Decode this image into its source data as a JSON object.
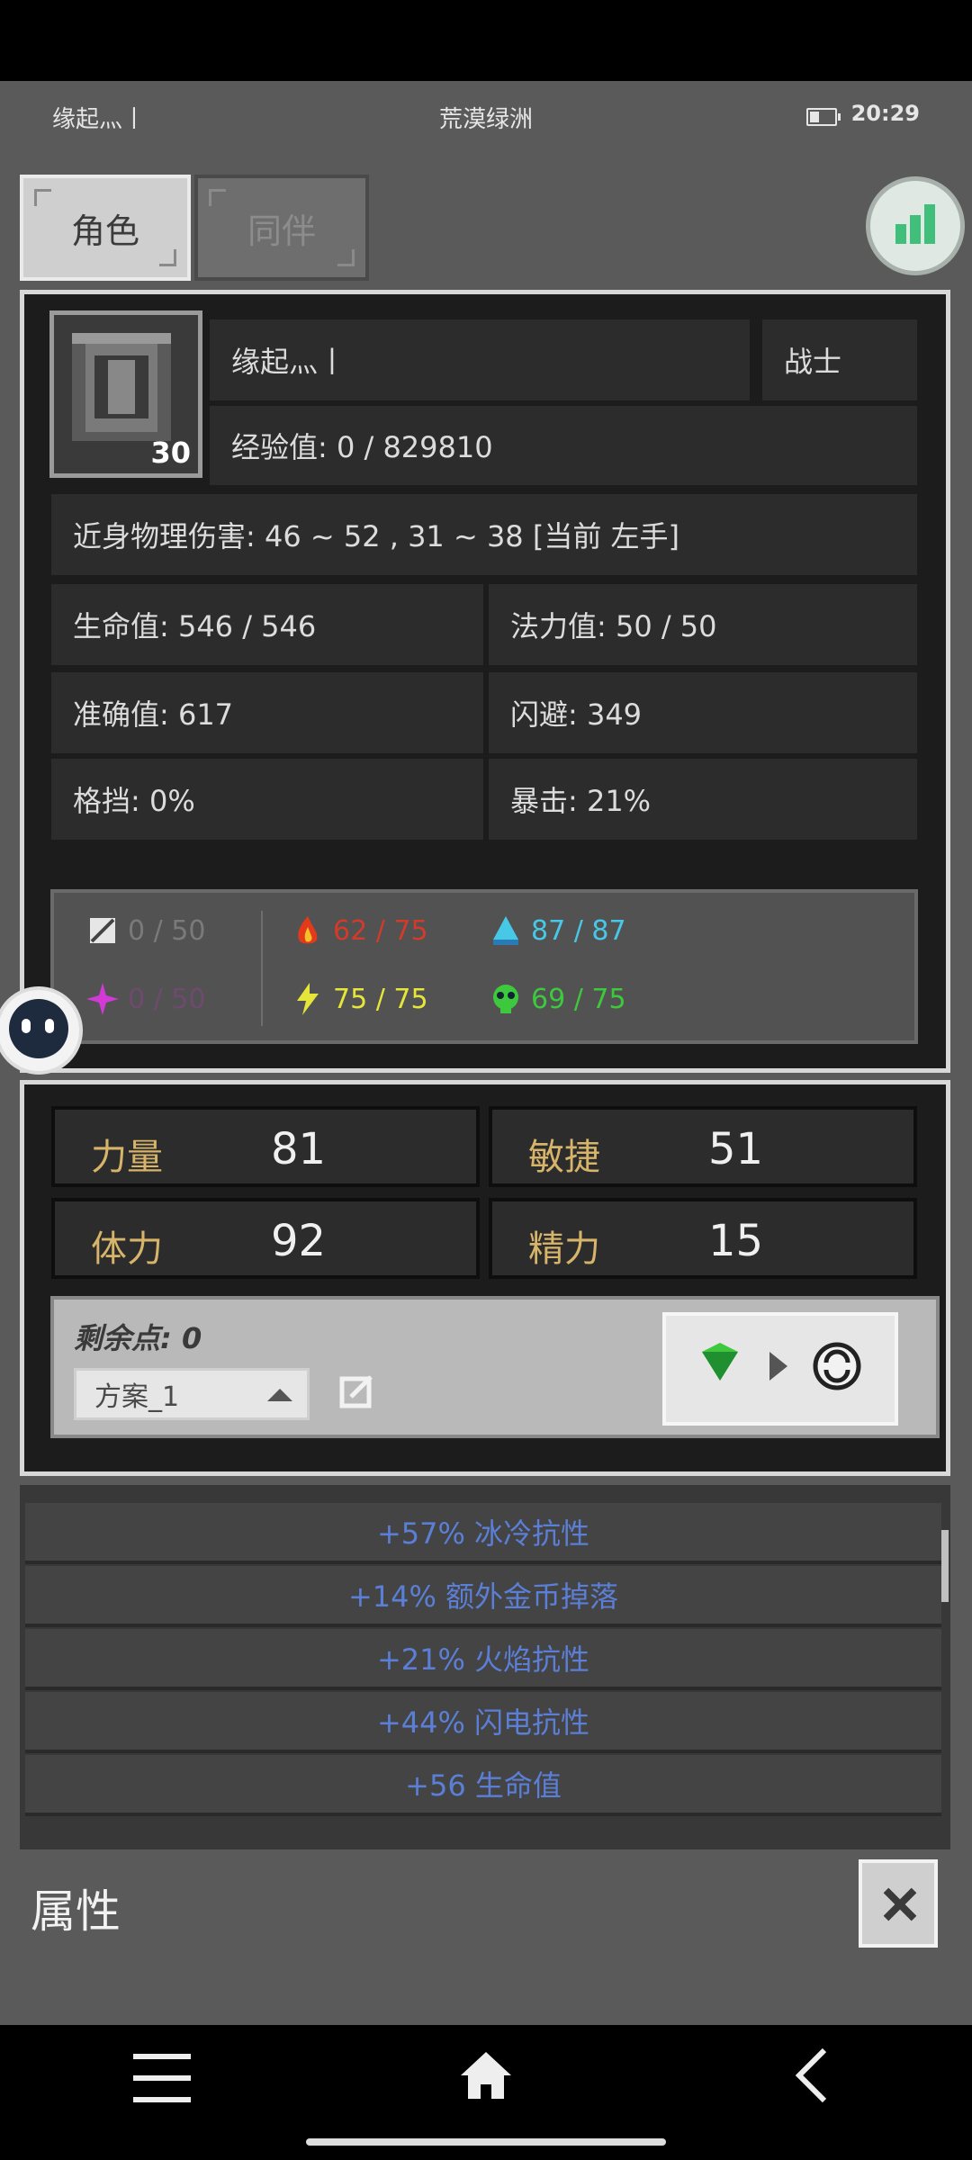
{
  "status_bar": {
    "left_text": "缘起灬丨",
    "title": "荒漠绿洲",
    "time": "20:29"
  },
  "tabs": [
    {
      "label": "角色"
    },
    {
      "label": "同伴"
    }
  ],
  "character": {
    "name": "缘起灬丨",
    "class": "战士",
    "level": "30",
    "exp_text": "经验值: 0 / 829810",
    "melee_damage_text": "近身物理伤害: 46 ~ 52 , 31 ~ 38 [当前 左手]",
    "hp_text": "生命值: 546 / 546",
    "mp_text": "法力值: 50 / 50",
    "accuracy_text": "准确值: 617",
    "dodge_text": "闪避: 349",
    "block_text": "格挡: 0%",
    "crit_text": "暴击: 21%"
  },
  "resistances": [
    {
      "icon": "physical-resist-icon",
      "text": "0 / 50",
      "color": "#7a7a7a"
    },
    {
      "icon": "fire-resist-icon",
      "text": "62 / 75",
      "color": "#d23a2a"
    },
    {
      "icon": "cold-resist-icon",
      "text": "87 / 87",
      "color": "#46c8e6"
    },
    {
      "icon": "magic-resist-icon",
      "text": "0 / 50",
      "color": "#6e4a6e"
    },
    {
      "icon": "lightning-resist-icon",
      "text": "75 / 75",
      "color": "#e6e63a"
    },
    {
      "icon": "poison-resist-icon",
      "text": "69 / 75",
      "color": "#3ec83e"
    }
  ],
  "attributes": [
    {
      "name": "力量",
      "value": "81"
    },
    {
      "name": "敏捷",
      "value": "51"
    },
    {
      "name": "体力",
      "value": "92"
    },
    {
      "name": "精力",
      "value": "15"
    }
  ],
  "points": {
    "remaining_text": "剩余点: 0",
    "scheme": "方案_1"
  },
  "bonus_list": [
    "+57% 冰冷抗性",
    "+14% 额外金币掉落",
    "+21% 火焰抗性",
    "+44% 闪电抗性",
    "+56 生命值"
  ],
  "footer": {
    "title": "属性"
  }
}
